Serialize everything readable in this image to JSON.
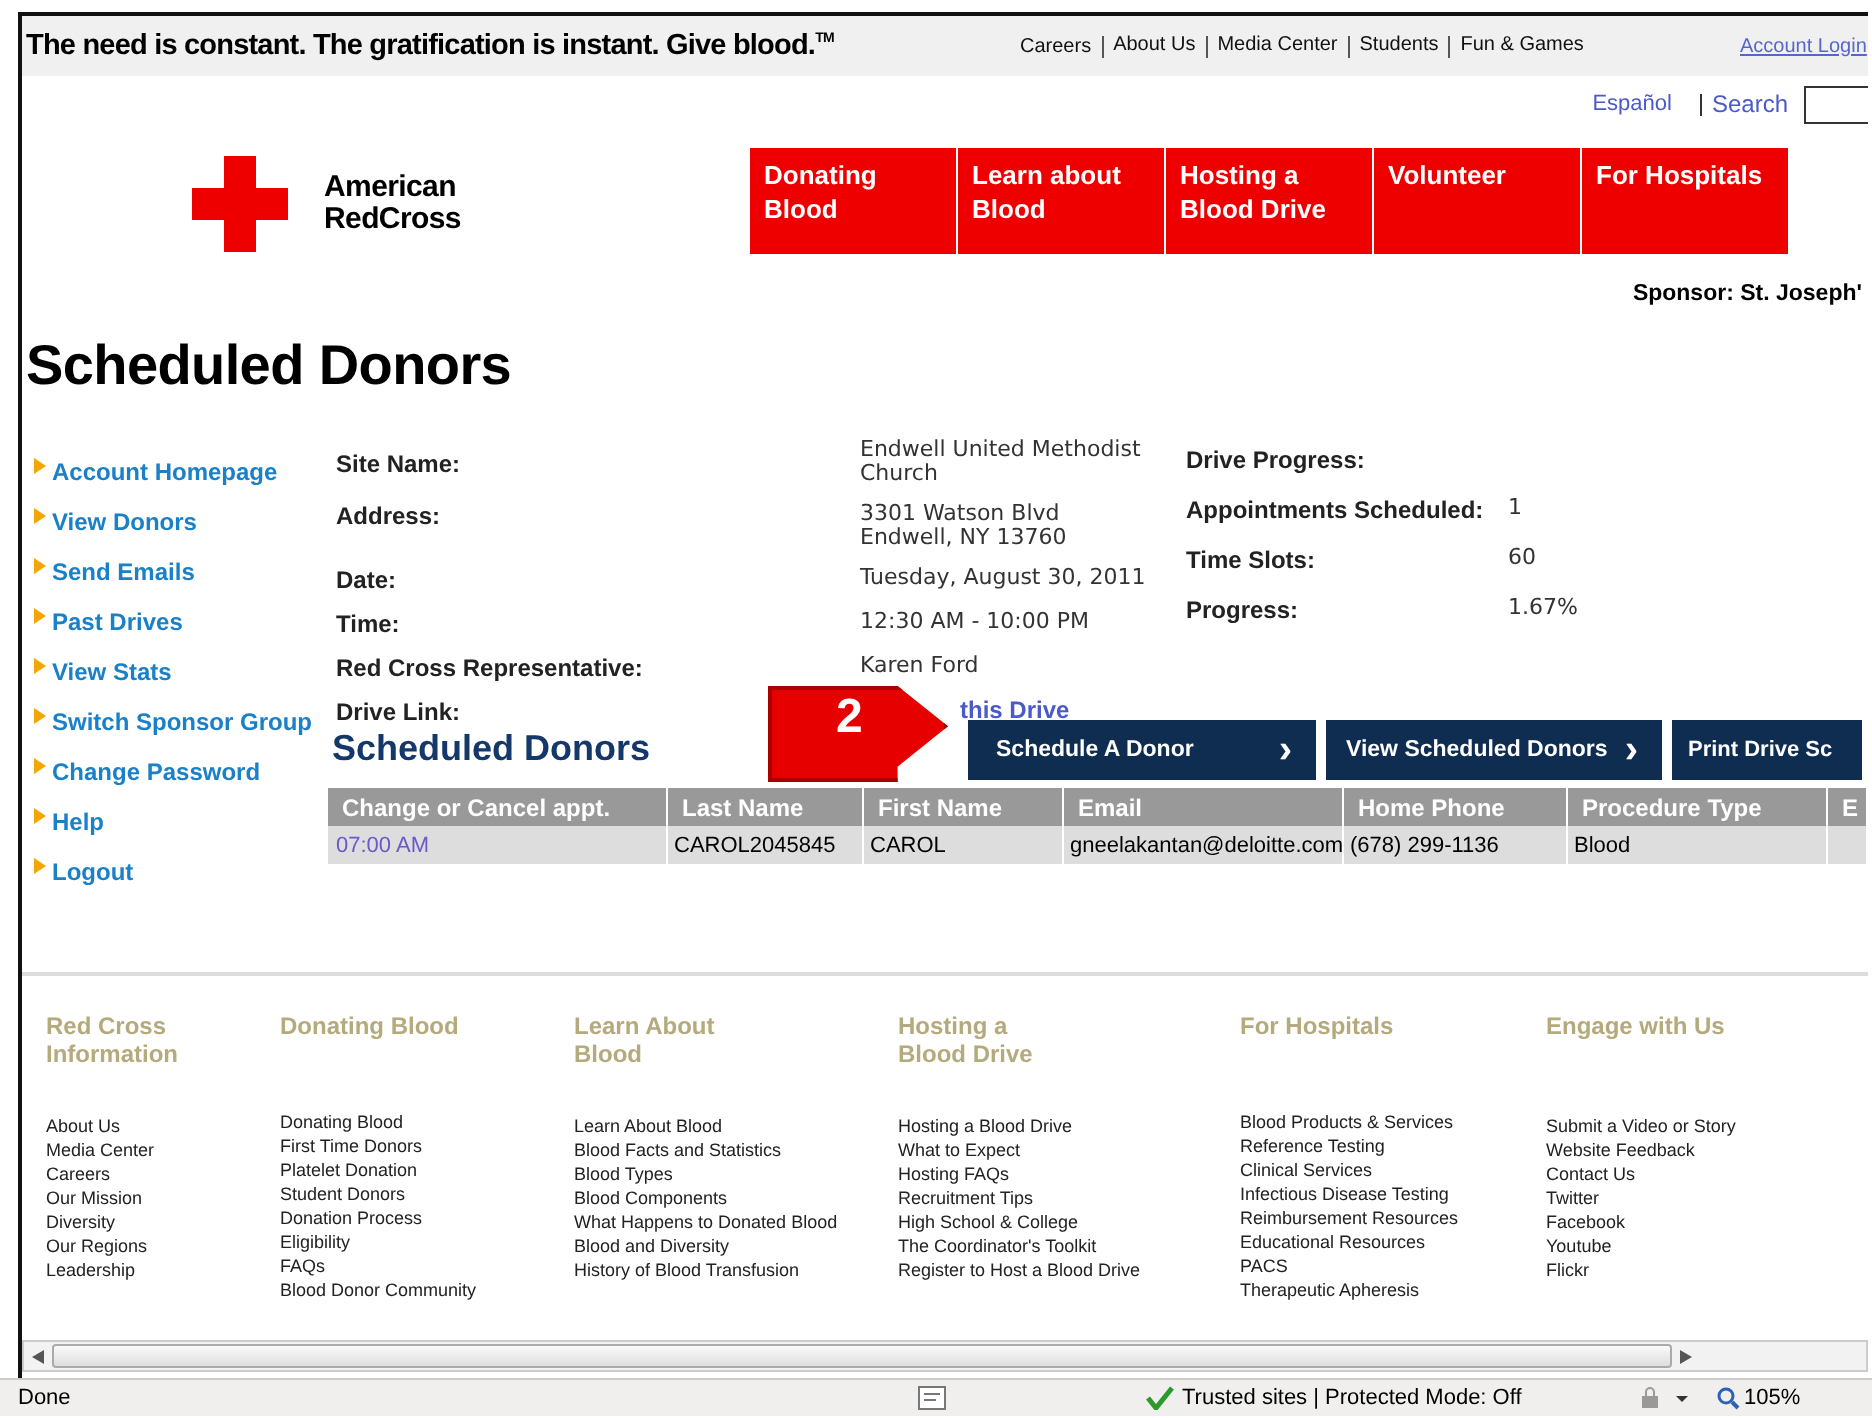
{
  "top_bar": {
    "tagline": "The need is constant. The gratification is instant. Give blood.",
    "tagline_mark": "TM",
    "links": [
      "Careers",
      "About Us",
      "Media Center",
      "Students",
      "Fun & Games"
    ],
    "account_link": "Account Login"
  },
  "utility": {
    "language": "Español",
    "search": "Search"
  },
  "logo": {
    "line1": "American",
    "line2": "RedCross"
  },
  "nav": [
    "Donating Blood",
    "Learn about Blood",
    "Hosting a Blood Drive",
    "Volunteer",
    "For Hospitals"
  ],
  "sponsor": "Sponsor: St. Joseph'",
  "page_title": "Scheduled Donors",
  "sidebar": [
    "Account Homepage",
    "View Donors",
    "Send Emails",
    "Past Drives",
    "View Stats",
    "Switch Sponsor Group",
    "Change Password",
    "Help",
    "Logout"
  ],
  "details": [
    {
      "label": "Site Name:",
      "value": "Endwell United Methodist Church"
    },
    {
      "label": "Address:",
      "value": "3301 Watson Blvd\nEndwell, NY 13760"
    },
    {
      "label": "Date:",
      "value": "Tuesday, August 30, 2011"
    },
    {
      "label": "Time:",
      "value": "12:30 AM - 10:00 PM"
    },
    {
      "label": "Red Cross Representative:",
      "value": "Karen Ford"
    },
    {
      "label": "Drive Link:",
      "value": "this Drive",
      "kind": "link"
    }
  ],
  "progress": {
    "title": "Drive Progress:",
    "rows": [
      {
        "label": "Appointments Scheduled:",
        "value": "1"
      },
      {
        "label": "Time Slots:",
        "value": "60"
      },
      {
        "label": "Progress:",
        "value": "1.67%"
      }
    ]
  },
  "section_title": "Scheduled Donors",
  "callout": "2",
  "actions": [
    {
      "label": "Schedule A Donor",
      "icon": "›"
    },
    {
      "label": "View Scheduled Donors",
      "icon": "›"
    },
    {
      "label": "Print Drive Sc"
    }
  ],
  "table": {
    "columns": [
      "Change or Cancel appt.",
      "Last Name",
      "First Name",
      "Email",
      "Home Phone",
      "Procedure Type",
      "E"
    ],
    "rows": [
      [
        "07:00 AM",
        "CAROL2045845",
        "CAROL",
        "gneelakantan@deloitte.com",
        "(678) 299-1136",
        "Blood",
        ""
      ]
    ]
  },
  "footer": [
    {
      "title": "Red Cross Information",
      "links": [
        "About Us",
        "Media Center",
        "Careers",
        "Our Mission",
        "Diversity",
        "Our Regions",
        "Leadership"
      ]
    },
    {
      "title": "Donating Blood",
      "links": [
        "Donating Blood",
        "First Time Donors",
        "Platelet Donation",
        "Student Donors",
        "Donation Process",
        "Eligibility",
        "FAQs",
        "Blood Donor Community"
      ]
    },
    {
      "title": "Learn About Blood",
      "links": [
        "Learn About Blood",
        "Blood Facts and Statistics",
        "Blood Types",
        "Blood Components",
        "What Happens to Donated Blood",
        "Blood and Diversity",
        "History of Blood Transfusion"
      ]
    },
    {
      "title": "Hosting a Blood Drive",
      "links": [
        "Hosting a Blood Drive",
        "What to Expect",
        "Hosting FAQs",
        "Recruitment Tips",
        "High School & College",
        "The Coordinator's Toolkit",
        "Register to Host a Blood Drive"
      ]
    },
    {
      "title": "For Hospitals",
      "links": [
        "Blood Products & Services",
        "Reference Testing",
        "Clinical Services",
        "Infectious Disease Testing",
        "Reimbursement Resources",
        "Educational Resources",
        "PACS",
        "Therapeutic Apheresis"
      ]
    },
    {
      "title": "Engage with Us",
      "links": [
        "Submit a Video or Story",
        "Website Feedback",
        "Contact Us",
        "Twitter",
        "Facebook",
        "Youtube",
        "Flickr"
      ]
    }
  ],
  "status_bar": {
    "text": "Done",
    "zone": "Trusted sites | Protected Mode: Off",
    "zoom": "105%"
  }
}
